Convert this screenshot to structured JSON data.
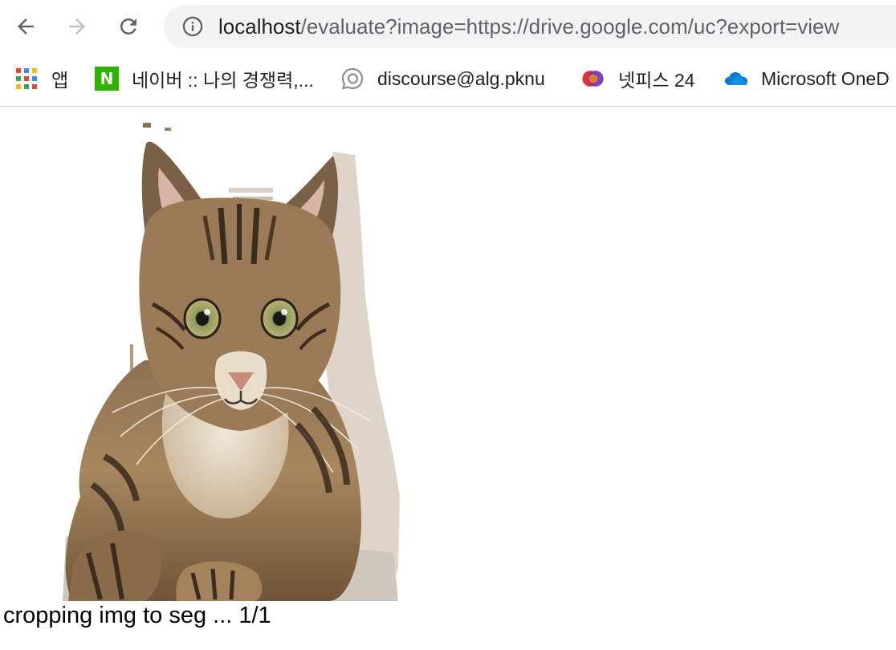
{
  "browser": {
    "nav": {
      "back_icon": "arrow-left-icon",
      "forward_icon": "arrow-right-icon",
      "reload_icon": "reload-icon"
    },
    "omnibox": {
      "icon": "info-icon",
      "url_host": "localhost",
      "url_rest": "/evaluate?image=https://drive.google.com/uc?export=view"
    },
    "bookmarks": [
      {
        "label": "앱",
        "icon": "apps-grid-icon"
      },
      {
        "label": "네이버 :: 나의 경쟁력,...",
        "icon": "naver-icon"
      },
      {
        "label": "discourse@alg.pknu",
        "icon": "discourse-icon"
      },
      {
        "label": "넷피스 24",
        "icon": "netffice-icon"
      },
      {
        "label": "Microsoft OneD",
        "icon": "onedrive-icon"
      }
    ]
  },
  "page": {
    "image_subject": "segmented-cat-image",
    "status": "cropping img to seg ... 1/1"
  },
  "colors": {
    "omnibox_bg": "#f1f3f4",
    "naver_green": "#2db400",
    "onedrive_blue": "#0f78d4"
  }
}
